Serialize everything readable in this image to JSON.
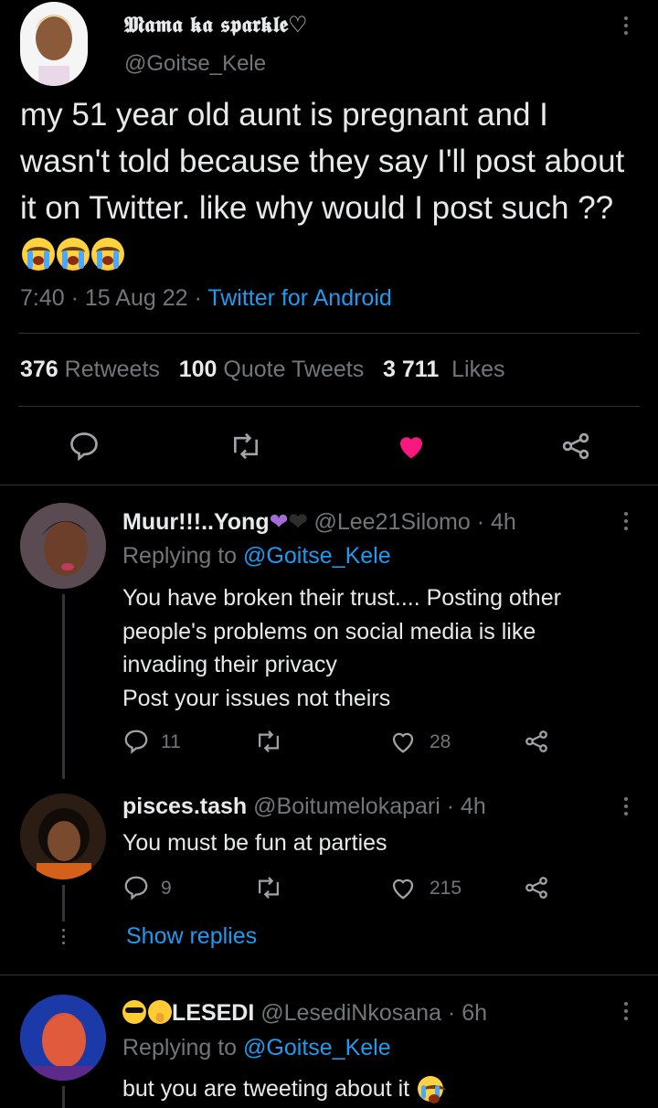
{
  "tweet": {
    "display_name": "𝕸𝖆𝖒𝖆 𝖐𝖆 𝖘𝖕𝖆𝖗𝖐𝖑𝖊♡",
    "handle": "@Goitse_Kele",
    "text": "my 51 year old aunt is pregnant  and I wasn't told because they say I'll post about it on Twitter. like why would I post such ??",
    "time": "7:40",
    "date": "15 Aug 22",
    "source": "Twitter for Android",
    "stats": {
      "retweets_count": "376",
      "retweets_label": "Retweets",
      "quotes_count": "100",
      "quotes_label": "Quote Tweets",
      "likes_count": "3 711",
      "likes_label": "Likes"
    },
    "liked": true,
    "accent_color": "#1d9bf0",
    "like_color": "#f91880"
  },
  "replies": [
    {
      "name": "Muur!!!..Yong",
      "name_emojis": [
        "purple-heart",
        "black-heart"
      ],
      "handle": "@Lee21Silomo",
      "time": "4h",
      "replying_label": "Replying to",
      "replying_handle": "@Goitse_Kele",
      "lines": [
        "You have broken their trust.... Posting other",
        "people's problems on social media is like",
        "invading their privacy",
        "Post your issues not theirs"
      ],
      "reply_count": "11",
      "like_count": "28"
    },
    {
      "name": "pisces.tash",
      "handle": "@Boitumelokapari",
      "time": "4h",
      "lines": [
        "You must be fun at parties"
      ],
      "reply_count": "9",
      "like_count": "215",
      "show_replies": "Show replies"
    },
    {
      "name": "LESEDI",
      "name_emojis": [
        "sunglasses-face",
        "shushing-face"
      ],
      "handle": "@LesediNkosana",
      "time": "6h",
      "replying_label": "Replying to",
      "replying_handle": "@Goitse_Kele",
      "lines": [
        "but you are tweeting about it"
      ]
    }
  ],
  "separator": "·"
}
